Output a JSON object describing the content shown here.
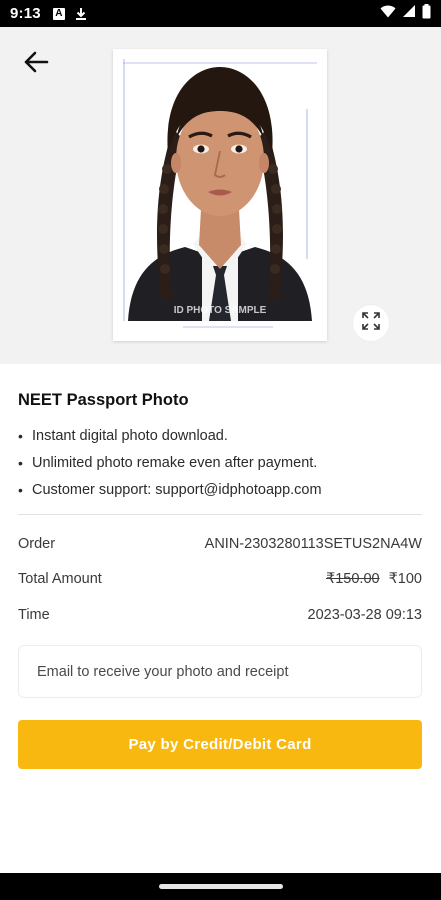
{
  "status_bar": {
    "time": "9:13",
    "icons": [
      "authenticator-icon",
      "download-icon",
      "wifi-icon",
      "signal-icon",
      "battery-icon"
    ],
    "app_badge_letter": "A"
  },
  "hero": {
    "photo_watermark": "ID PHOTO SAMPLE",
    "icons": {
      "back": "arrow-left-icon",
      "expand": "fullscreen-icon"
    },
    "background_color": "#f2f2f2"
  },
  "product": {
    "title": "NEET Passport Photo",
    "features": [
      "Instant digital photo download.",
      "Unlimited photo remake even after payment.",
      "Customer support: support@idphotoapp.com"
    ]
  },
  "order": {
    "order_label": "Order",
    "order_value": "ANIN-2303280113SETUS2NA4W",
    "amount_label": "Total Amount",
    "original_price": "₹150.00",
    "price": "₹100",
    "time_label": "Time",
    "time_value": "2023-03-28 09:13"
  },
  "email": {
    "placeholder": "Email to receive your photo and receipt",
    "value": ""
  },
  "pay_button": {
    "label": "Pay by Credit/Debit Card",
    "color": "#f9b80f"
  }
}
